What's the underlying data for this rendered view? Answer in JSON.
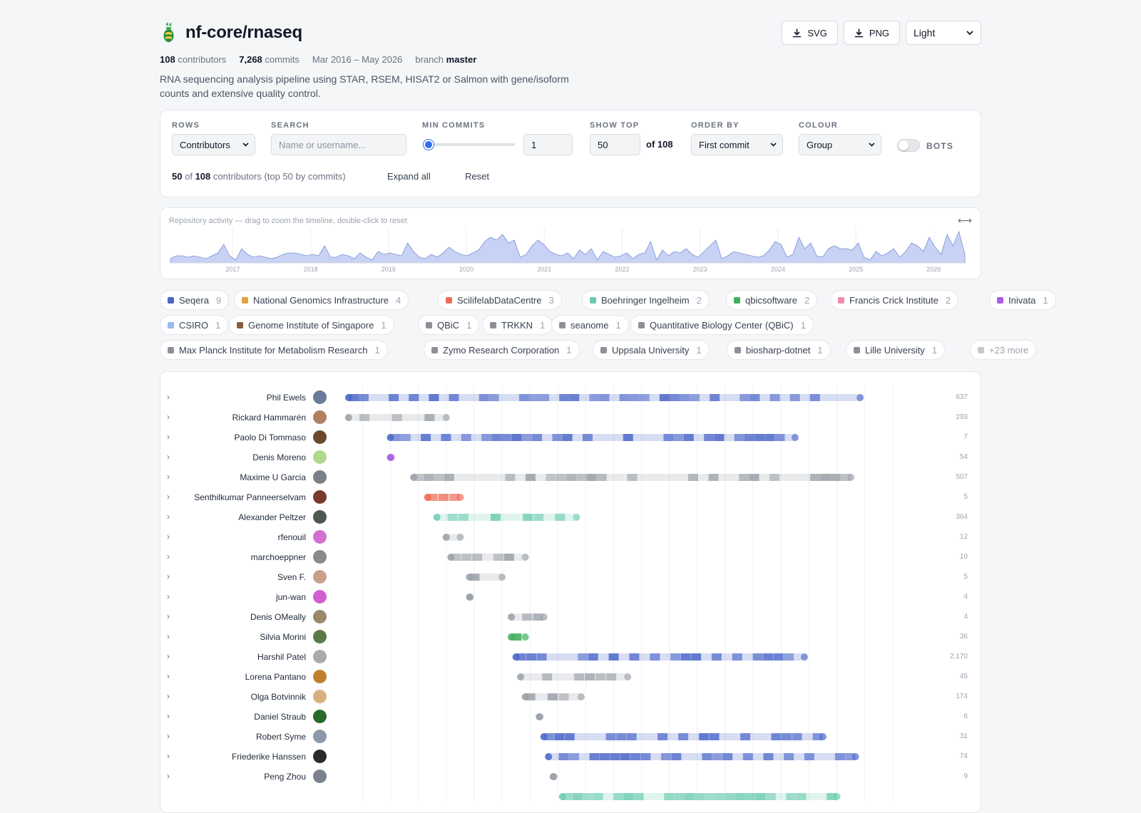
{
  "repo": {
    "name": "nf-core/rnaseq",
    "contributors_count": "108",
    "contributors_label": "contributors",
    "commits_count": "7,268",
    "commits_label": "commits",
    "date_range": "Mar 2016 – May 2026",
    "branch_label": "branch",
    "branch": "master",
    "description": "RNA sequencing analysis pipeline using STAR, RSEM, HISAT2 or Salmon with gene/isoform counts and extensive quality control."
  },
  "actions": {
    "svg": "SVG",
    "png": "PNG",
    "theme": "Light"
  },
  "controls": {
    "rows_label": "ROWS",
    "rows_value": "Contributors",
    "search_label": "SEARCH",
    "search_placeholder": "Name or username...",
    "min_commits_label": "MIN COMMITS",
    "min_commits_value": "1",
    "show_top_label": "SHOW TOP",
    "show_top_value": "50",
    "show_top_of": "of 108",
    "order_label": "ORDER BY",
    "order_value": "First commit",
    "colour_label": "COLOUR",
    "colour_value": "Group",
    "bots_label": "BOTS",
    "summary_shown": "50",
    "summary_of": "of",
    "summary_total": "108",
    "summary_rest": "contributors (top 50 by commits)",
    "expand_all": "Expand all",
    "reset": "Reset"
  },
  "activity": {
    "label": "Repository activity — drag to zoom the timeline, double-click to reset",
    "years": [
      "2017",
      "2018",
      "2019",
      "2020",
      "2021",
      "2022",
      "2023",
      "2024",
      "2025",
      "2026"
    ],
    "values": [
      3,
      5,
      5,
      4,
      5,
      4,
      3,
      5,
      7,
      13,
      5,
      2,
      10,
      6,
      4,
      5,
      4,
      3,
      4,
      6,
      7,
      7,
      6,
      5,
      6,
      5,
      12,
      4,
      4,
      6,
      5,
      3,
      7,
      4,
      2,
      8,
      6,
      7,
      6,
      5,
      14,
      8,
      4,
      3,
      6,
      4,
      7,
      11,
      8,
      6,
      5,
      7,
      9,
      15,
      18,
      16,
      20,
      14,
      16,
      4,
      6,
      12,
      16,
      13,
      8,
      6,
      5,
      7,
      3,
      9,
      6,
      10,
      2,
      8,
      6,
      4,
      5,
      7,
      3,
      6,
      7,
      15,
      2,
      9,
      5,
      8,
      7,
      10,
      6,
      4,
      8,
      12,
      16,
      3,
      5,
      8,
      7,
      6,
      5,
      4,
      5,
      9,
      15,
      13,
      4,
      6,
      18,
      10,
      14,
      5,
      4,
      10,
      12,
      10,
      10,
      9,
      14,
      4,
      2,
      8,
      5,
      7,
      10,
      4,
      8,
      14,
      12,
      8,
      18,
      11,
      6,
      20,
      12,
      22,
      6
    ],
    "color": "#c7d2f4",
    "stroke": "#7b8fd6"
  },
  "groups": [
    {
      "name": "Seqera",
      "count": "9",
      "color": "#4a66c9"
    },
    {
      "name": "National Genomics Infrastructure",
      "count": "4",
      "color": "#e3a23a"
    },
    {
      "name": "ScilifelabDataCentre",
      "count": "3",
      "color": "#ee6a55"
    },
    {
      "name": "Boehringer Ingelheim",
      "count": "2",
      "color": "#6ccbb0"
    },
    {
      "name": "qbicsoftware",
      "count": "2",
      "color": "#3fae5a"
    },
    {
      "name": "Francis Crick Institute",
      "count": "2",
      "color": "#f08bb3"
    },
    {
      "name": "Inivata",
      "count": "1",
      "color": "#a55fe0"
    },
    {
      "name": "CSIRO",
      "count": "1",
      "color": "#9ab9f0"
    },
    {
      "name": "Genome Institute of Singapore",
      "count": "1",
      "color": "#8b5a3c"
    },
    {
      "name": "QBiC",
      "count": "1",
      "color": "#8d9098"
    },
    {
      "name": "TRKKN",
      "count": "1",
      "color": "#8d9098"
    },
    {
      "name": "seanome",
      "count": "1",
      "color": "#8d9098"
    },
    {
      "name": "Quantitative Biology Center (QBiC)",
      "count": "1",
      "color": "#8d9098"
    },
    {
      "name": "Max Planck Institute for Metabolism Research",
      "count": "1",
      "color": "#8d9098"
    },
    {
      "name": "Zymo Research Corporation",
      "count": "1",
      "color": "#8d9098"
    },
    {
      "name": "Uppsala University",
      "count": "1",
      "color": "#8d9098"
    },
    {
      "name": "biosharp-dotnet",
      "count": "1",
      "color": "#8d9098"
    },
    {
      "name": "Lille University",
      "count": "1",
      "color": "#8d9098"
    }
  ],
  "more_groups": "+23 more",
  "contributors": [
    {
      "name": "Phil Ewels",
      "commits": "637",
      "group": "Seqera",
      "start": "2016-04",
      "end": "2025-06",
      "avatar": "#6b7a9a"
    },
    {
      "name": "Rickard Hammarén",
      "commits": "293",
      "group": "other",
      "start": "2016-04",
      "end": "2018-01",
      "avatar": "#b08060"
    },
    {
      "name": "Paolo Di Tommaso",
      "commits": "7",
      "group": "Seqera",
      "start": "2017-01",
      "end": "2024-04",
      "avatar": "#6a4a2a"
    },
    {
      "name": "Denis Moreno",
      "commits": "54",
      "group": "Inivata",
      "start": "2017-01",
      "end": "2017-01",
      "avatar": "#b0d88a"
    },
    {
      "name": "Maxime U Garcia",
      "commits": "507",
      "group": "other",
      "start": "2017-06",
      "end": "2025-04",
      "avatar": "#7a7f8a"
    },
    {
      "name": "Senthilkumar Panneerselvam",
      "commits": "5",
      "group": "ScilifelabDataCentre",
      "start": "2017-09",
      "end": "2018-04",
      "avatar": "#7a3a30"
    },
    {
      "name": "Alexander Peltzer",
      "commits": "364",
      "group": "Boehringer Ingelheim",
      "start": "2017-11",
      "end": "2020-05",
      "avatar": "#4a5a50"
    },
    {
      "name": "rfenouil",
      "commits": "12",
      "group": "other",
      "start": "2018-01",
      "end": "2018-04",
      "avatar": "#d070d0"
    },
    {
      "name": "marchoeppner",
      "commits": "10",
      "group": "other",
      "start": "2018-02",
      "end": "2019-06",
      "avatar": "#8a8a8a"
    },
    {
      "name": "Sven F.",
      "commits": "5",
      "group": "other",
      "start": "2018-06",
      "end": "2019-01",
      "avatar": "#c9a08a"
    },
    {
      "name": "jun-wan",
      "commits": "4",
      "group": "other",
      "start": "2018-06",
      "end": "2018-06",
      "avatar": "#d060d0"
    },
    {
      "name": "Denis OMeally",
      "commits": "4",
      "group": "other",
      "start": "2019-03",
      "end": "2019-10",
      "avatar": "#9a8a6a"
    },
    {
      "name": "Silvia Morini",
      "commits": "36",
      "group": "qbicsoftware",
      "start": "2019-03",
      "end": "2019-06",
      "avatar": "#5a7a4a"
    },
    {
      "name": "Harshil Patel",
      "commits": "2,170",
      "group": "Seqera",
      "start": "2019-04",
      "end": "2024-06",
      "avatar": "#aaaaaa"
    },
    {
      "name": "Lorena Pantano",
      "commits": "45",
      "group": "other",
      "start": "2019-05",
      "end": "2021-04",
      "avatar": "#c08030"
    },
    {
      "name": "Olga Botvinnik",
      "commits": "174",
      "group": "other",
      "start": "2019-06",
      "end": "2020-06",
      "avatar": "#d8b080"
    },
    {
      "name": "Daniel Straub",
      "commits": "6",
      "group": "other",
      "start": "2019-09",
      "end": "2019-09",
      "avatar": "#2a6a2a"
    },
    {
      "name": "Robert Syme",
      "commits": "31",
      "group": "Seqera",
      "start": "2019-10",
      "end": "2024-10",
      "avatar": "#8a9aaa"
    },
    {
      "name": "Friederike Hanssen",
      "commits": "74",
      "group": "Seqera",
      "start": "2019-11",
      "end": "2025-05",
      "avatar": "#2a2a2a"
    },
    {
      "name": "Peng Zhou",
      "commits": "9",
      "group": "other",
      "start": "2019-12",
      "end": "2019-12",
      "avatar": "#7a8090"
    },
    {
      "name": "",
      "commits": "",
      "group": "Boehringer Ingelheim",
      "start": "2020-02",
      "end": "2025-01",
      "avatar": "#6a7ab0"
    }
  ]
}
